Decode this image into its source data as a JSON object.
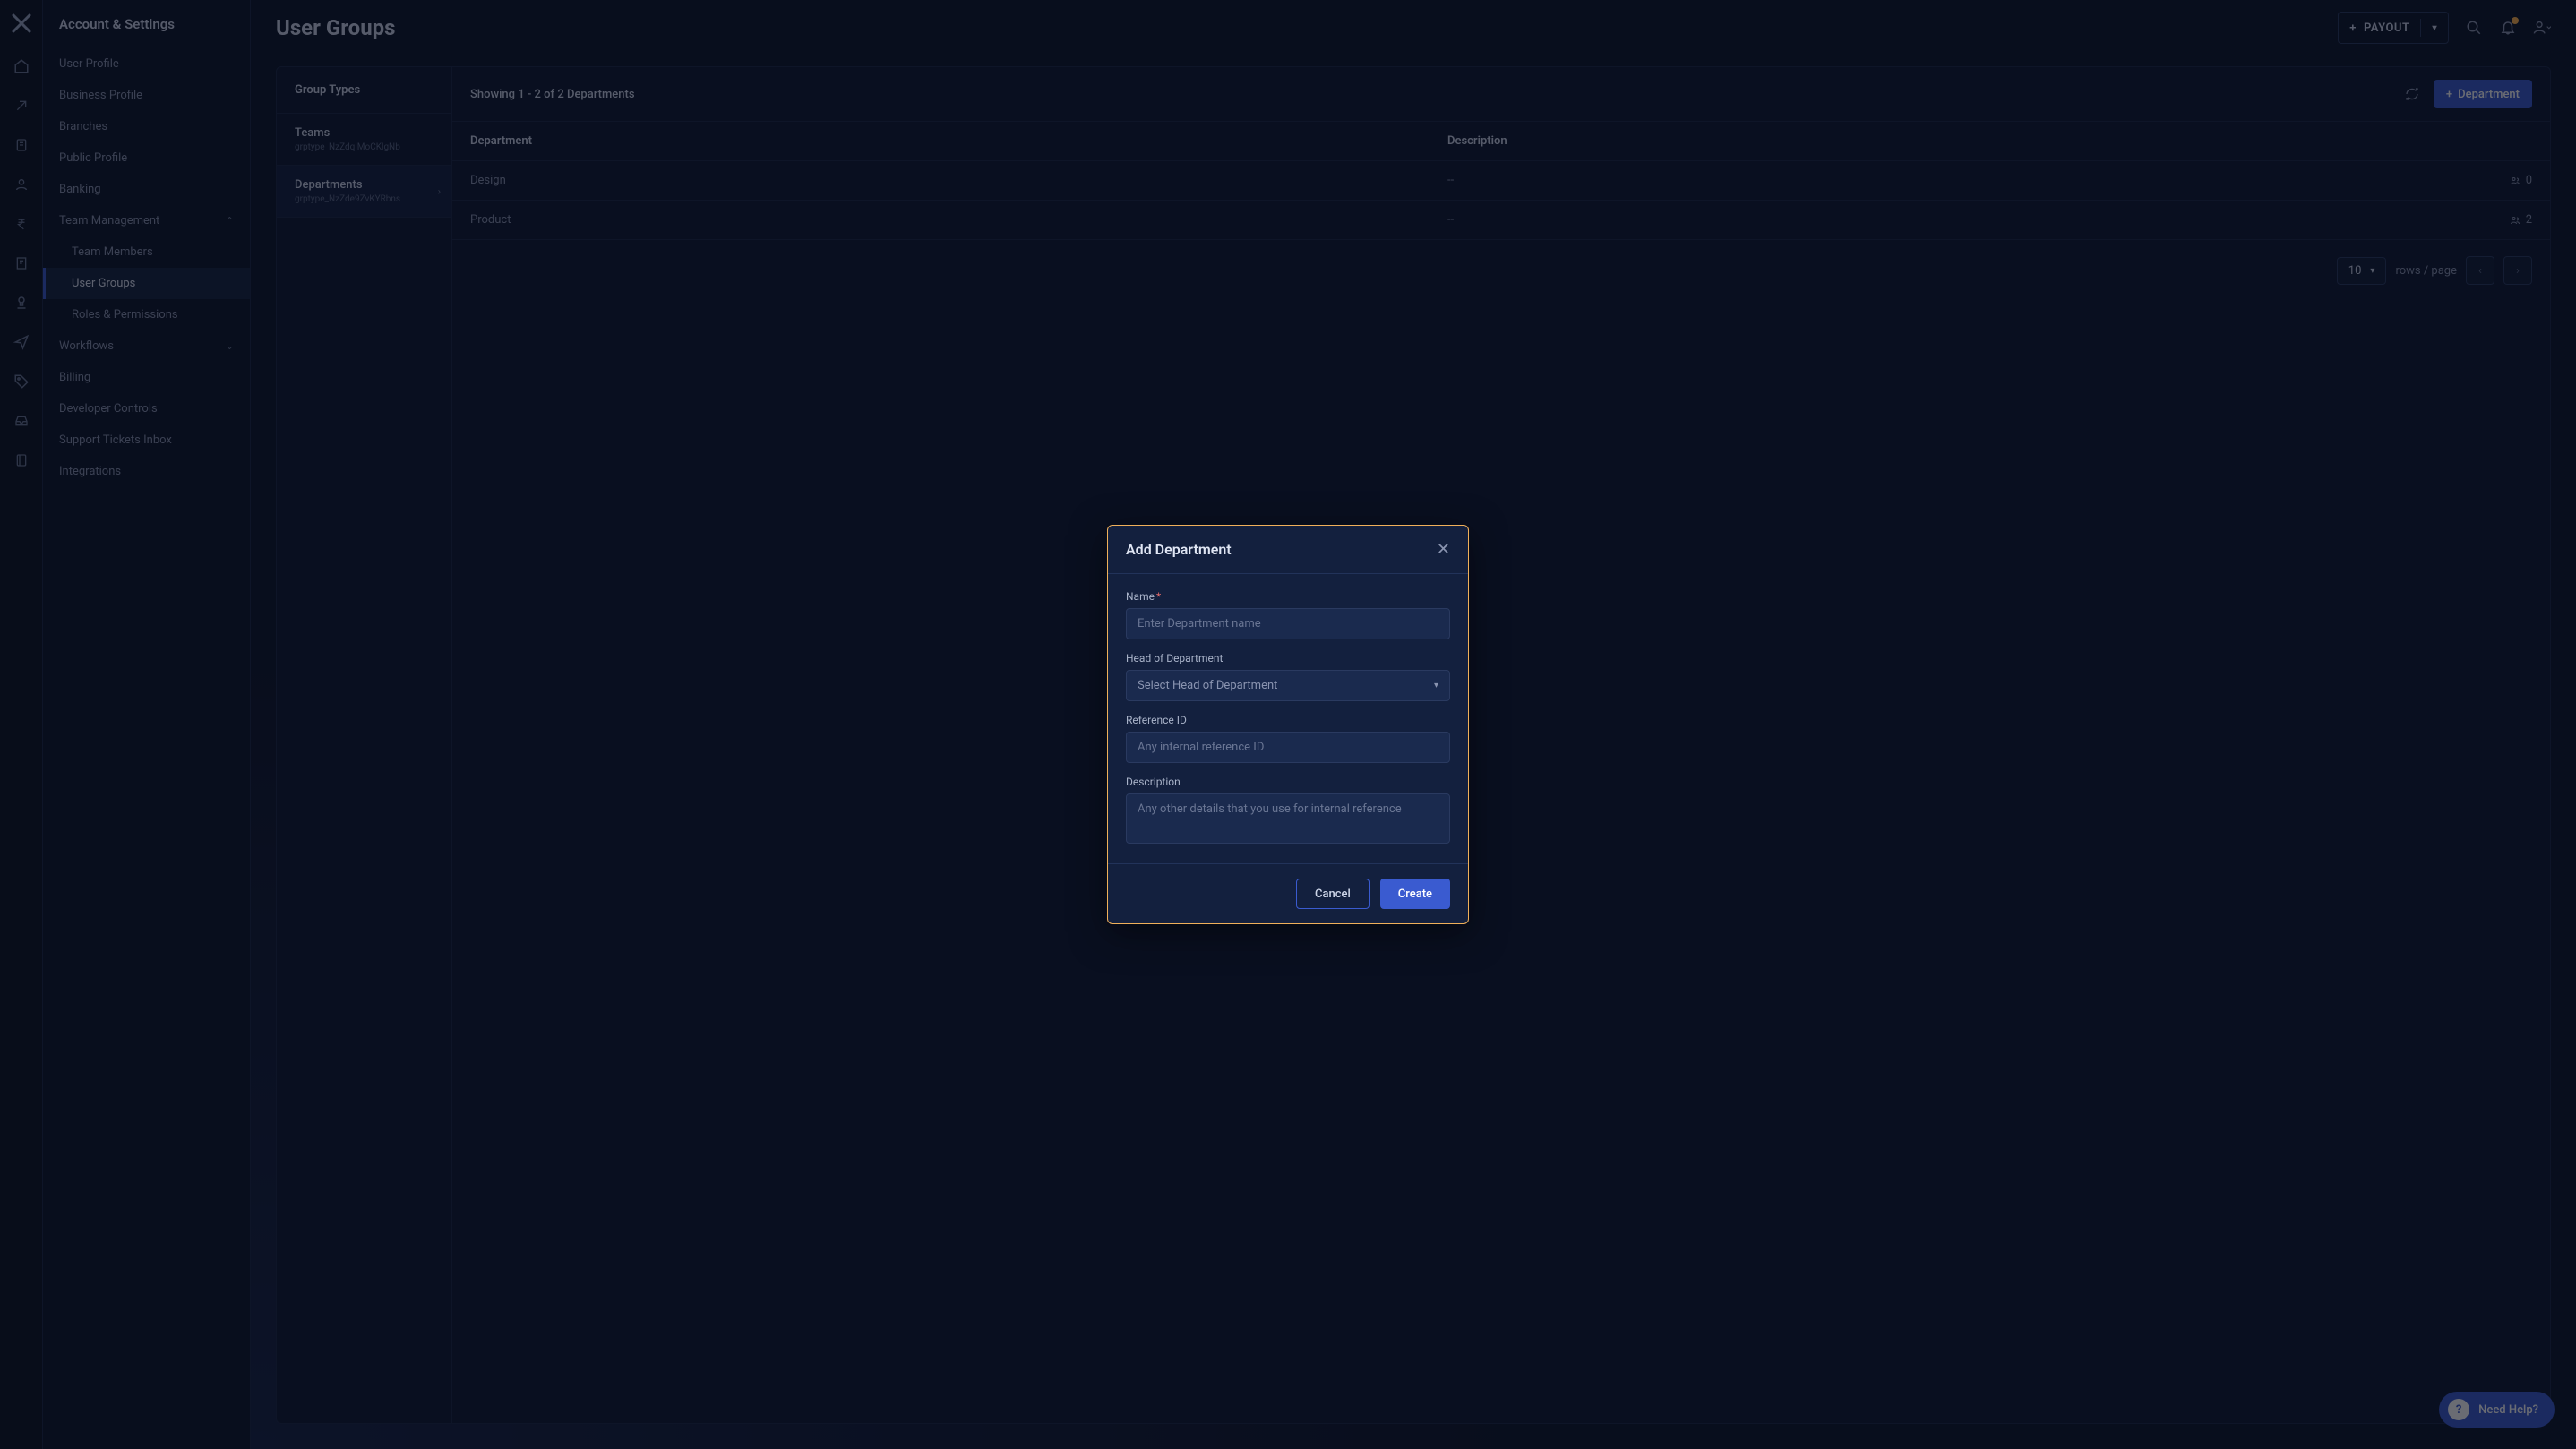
{
  "header": {
    "section": "Account & Settings",
    "title": "User Groups",
    "payout_label": "PAYOUT"
  },
  "sidebar": {
    "items": [
      "User Profile",
      "Business Profile",
      "Branches",
      "Public Profile",
      "Banking"
    ],
    "team_mgmt": {
      "label": "Team Management",
      "children": [
        "Team Members",
        "User Groups",
        "Roles & Permissions"
      ],
      "active_index": 1
    },
    "workflows_label": "Workflows",
    "rest": [
      "Billing",
      "Developer Controls",
      "Support Tickets Inbox",
      "Integrations"
    ]
  },
  "group_types": {
    "header": "Group Types",
    "items": [
      {
        "name": "Teams",
        "sub": "grptype_NzZdqiMoCKlgNb"
      },
      {
        "name": "Departments",
        "sub": "grptype_NzZde9ZvKYRbns"
      }
    ],
    "active_index": 1
  },
  "table": {
    "summary": "Showing 1 - 2 of 2 Departments",
    "add_button": "Department",
    "columns": [
      "Department",
      "Description",
      ""
    ],
    "rows": [
      {
        "name": "Design",
        "desc": "--",
        "count": "0"
      },
      {
        "name": "Product",
        "desc": "--",
        "count": "2"
      }
    ],
    "rows_per_page": "10",
    "rows_label": "rows / page"
  },
  "modal": {
    "title": "Add Department",
    "fields": {
      "name": {
        "label": "Name",
        "placeholder": "Enter Department name"
      },
      "head": {
        "label": "Head of Department",
        "placeholder": "Select Head of Department"
      },
      "ref": {
        "label": "Reference ID",
        "placeholder": "Any internal reference ID"
      },
      "desc": {
        "label": "Description",
        "placeholder": "Any other details that you use for internal reference"
      }
    },
    "cancel": "Cancel",
    "create": "Create"
  },
  "help": {
    "label": "Need Help?"
  }
}
